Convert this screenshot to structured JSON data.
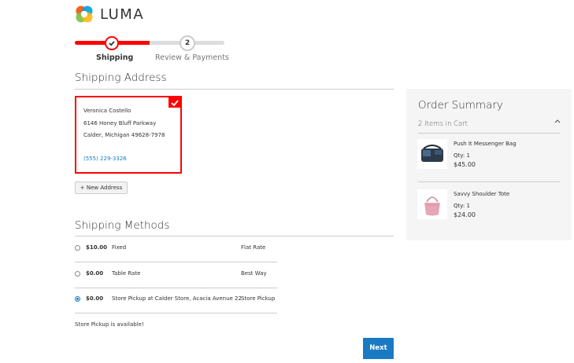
{
  "logo": {
    "text": "LUMA"
  },
  "progress": {
    "step1_label": "Shipping",
    "step2_number": "2",
    "step2_label": "Review & Payments"
  },
  "shipping_address": {
    "title": "Shipping Address",
    "name": "Veronica Costello",
    "street": "6146 Honey Bluff Parkway",
    "city_line": "Calder, Michigan 49628-7978",
    "phone": "(555) 229-3326",
    "new_address_button": "+ New Address"
  },
  "shipping_methods": {
    "title": "Shipping Methods",
    "rows": [
      {
        "price": "$10.00",
        "method": "Fixed",
        "carrier": "Flat Rate",
        "selected": false
      },
      {
        "price": "$0.00",
        "method": "Table Rate",
        "carrier": "Best Way",
        "selected": false
      },
      {
        "price": "$0.00",
        "method": "Store Pickup at Calder Store, Acacia Avenue 22",
        "carrier": "Store Pickup",
        "selected": true
      }
    ],
    "note": "Store Pickup is available!",
    "next_button": "Next"
  },
  "order_summary": {
    "title": "Order Summary",
    "count_label": "2 Items in Cart",
    "items": [
      {
        "name": "Push It Messenger Bag",
        "qty": "Qty: 1",
        "price": "$45.00"
      },
      {
        "name": "Savvy Shoulder Tote",
        "qty": "Qty: 1",
        "price": "$24.00"
      }
    ]
  },
  "colors": {
    "accent_red": "#ff0101",
    "primary_blue": "#1979c3"
  }
}
